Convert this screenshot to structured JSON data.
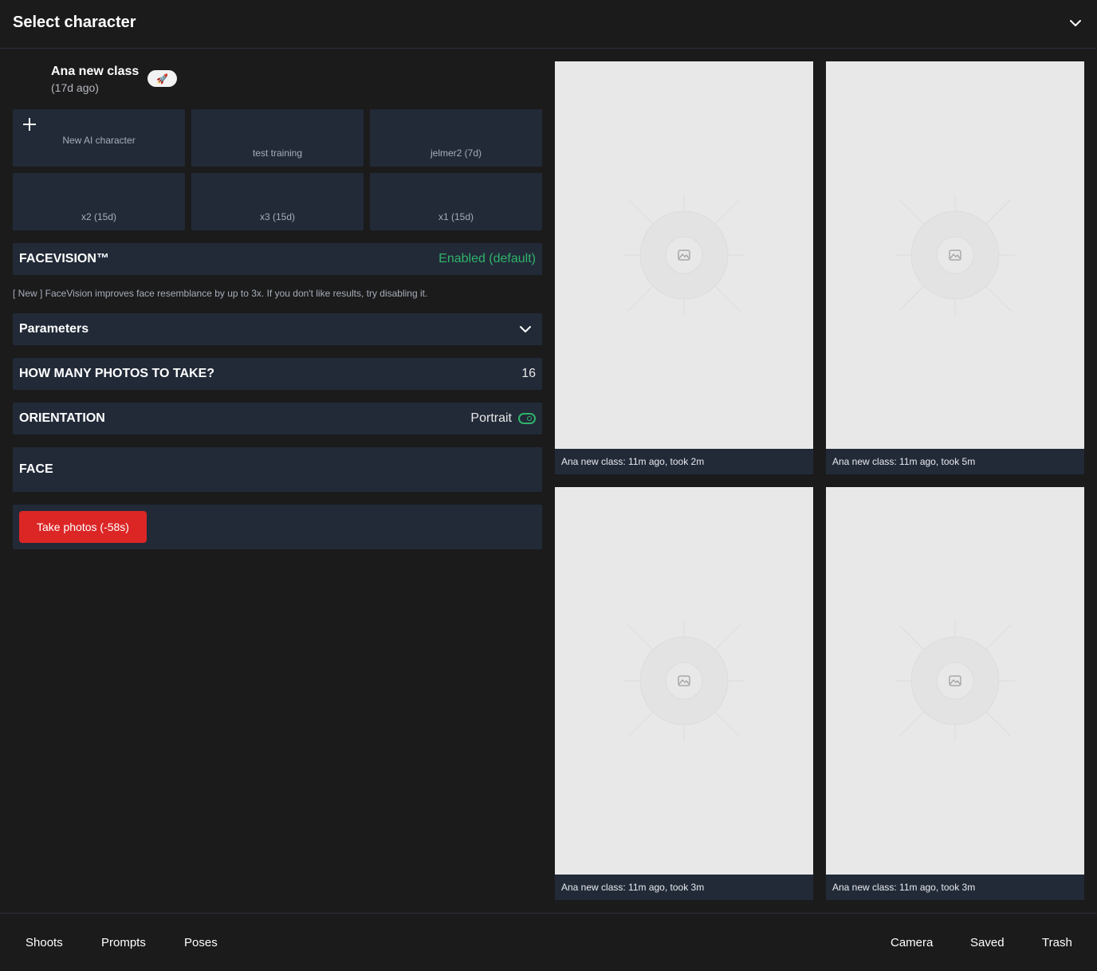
{
  "header": {
    "title": "Select character",
    "chevron_icon": "chevron-down-icon"
  },
  "selected_character": {
    "name": "Ana new class",
    "age": "(17d ago)",
    "badge_icon": "rocket-icon",
    "badge_glyph": "🚀"
  },
  "characters": [
    {
      "label": "New AI character",
      "icon": "plus-icon"
    },
    {
      "label": "test training"
    },
    {
      "label": "jelmer2 (7d)"
    },
    {
      "label": "x2 (15d)"
    },
    {
      "label": "x3 (15d)"
    },
    {
      "label": "x1 (15d)"
    }
  ],
  "facevision": {
    "title": "FACEVISION™",
    "status": "Enabled (default)",
    "status_color": "#2fb36a",
    "note": "[ New ] FaceVision improves face resemblance by up to 3x. If you don't like results, try disabling it."
  },
  "parameters": {
    "title": "Parameters"
  },
  "photo_count": {
    "title": "HOW MANY PHOTOS TO TAKE?",
    "value": "16"
  },
  "orientation": {
    "title": "ORIENTATION",
    "value": "Portrait",
    "toggle_on": true
  },
  "face": {
    "title": "FACE"
  },
  "action": {
    "label": "Take photos (-58s)",
    "color": "#dc2626"
  },
  "photos": [
    {
      "caption": "Ana new class: 11m ago, took 2m"
    },
    {
      "caption": "Ana new class: 11m ago, took 5m"
    },
    {
      "caption": "Ana new class: 11m ago, took 3m"
    },
    {
      "caption": "Ana new class: 11m ago, took 3m"
    }
  ],
  "nav_left": [
    "Shoots",
    "Prompts",
    "Poses"
  ],
  "nav_right": [
    "Camera",
    "Saved",
    "Trash"
  ]
}
